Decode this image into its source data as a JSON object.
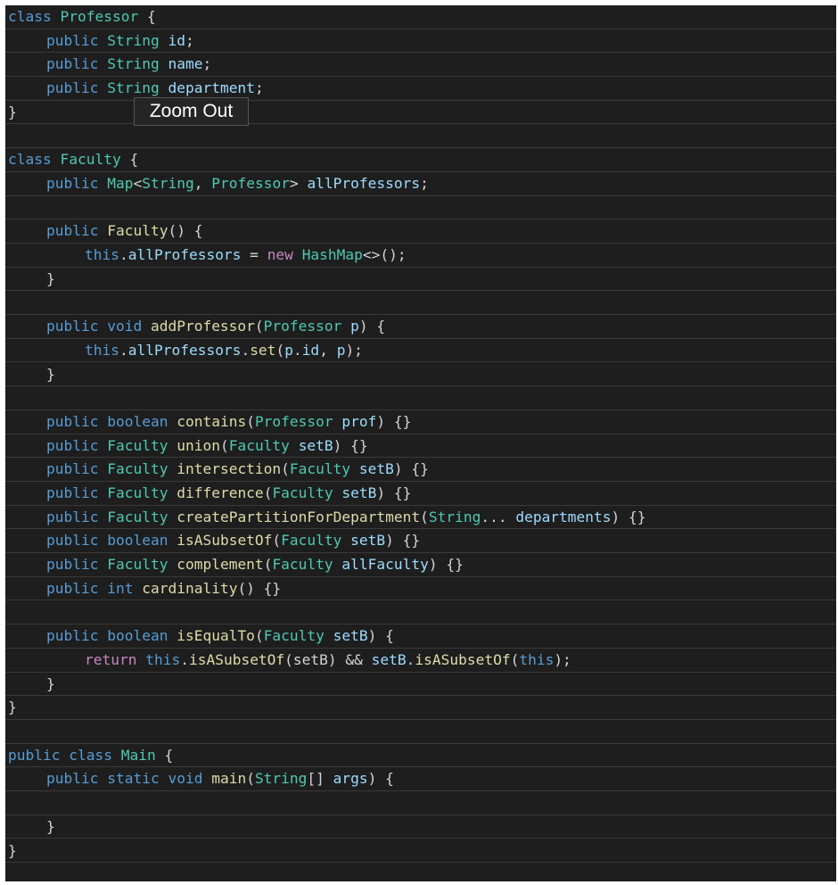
{
  "tooltip": {
    "label": "Zoom Out"
  },
  "colors": {
    "background": "#1e1e1e",
    "keyword": "#569cd6",
    "type": "#4ec9b0",
    "variable": "#9cdcfe",
    "function": "#dcdcaa",
    "control": "#c586c0",
    "punctuation": "#d4d4d4"
  },
  "lines": [
    {
      "indent": 0,
      "tokens": [
        [
          "kw",
          "class"
        ],
        [
          "p",
          " "
        ],
        [
          "type",
          "Professor"
        ],
        [
          "p",
          " {"
        ]
      ]
    },
    {
      "indent": 1,
      "tokens": [
        [
          "kw",
          "public"
        ],
        [
          "p",
          " "
        ],
        [
          "type",
          "String"
        ],
        [
          "p",
          " "
        ],
        [
          "var",
          "id"
        ],
        [
          "p",
          ";"
        ]
      ]
    },
    {
      "indent": 1,
      "tokens": [
        [
          "kw",
          "public"
        ],
        [
          "p",
          " "
        ],
        [
          "type",
          "String"
        ],
        [
          "p",
          " "
        ],
        [
          "var",
          "name"
        ],
        [
          "p",
          ";"
        ]
      ]
    },
    {
      "indent": 1,
      "tokens": [
        [
          "kw",
          "public"
        ],
        [
          "p",
          " "
        ],
        [
          "type",
          "String"
        ],
        [
          "p",
          " "
        ],
        [
          "var",
          "department"
        ],
        [
          "p",
          ";"
        ]
      ]
    },
    {
      "indent": 0,
      "tokens": [
        [
          "p",
          "}"
        ]
      ]
    },
    {
      "indent": 0,
      "tokens": []
    },
    {
      "indent": 0,
      "tokens": [
        [
          "kw",
          "class"
        ],
        [
          "p",
          " "
        ],
        [
          "type",
          "Faculty"
        ],
        [
          "p",
          " {"
        ]
      ]
    },
    {
      "indent": 1,
      "tokens": [
        [
          "kw",
          "public"
        ],
        [
          "p",
          " "
        ],
        [
          "type",
          "Map"
        ],
        [
          "p",
          "<"
        ],
        [
          "type",
          "String"
        ],
        [
          "p",
          ", "
        ],
        [
          "type",
          "Professor"
        ],
        [
          "p",
          "> "
        ],
        [
          "var",
          "allProfessors"
        ],
        [
          "p",
          ";"
        ]
      ]
    },
    {
      "indent": 0,
      "tokens": []
    },
    {
      "indent": 1,
      "tokens": [
        [
          "kw",
          "public"
        ],
        [
          "p",
          " "
        ],
        [
          "fn",
          "Faculty"
        ],
        [
          "p",
          "() {"
        ]
      ]
    },
    {
      "indent": 2,
      "tokens": [
        [
          "kw",
          "this"
        ],
        [
          "p",
          "."
        ],
        [
          "var",
          "allProfessors"
        ],
        [
          "p",
          " = "
        ],
        [
          "ctl",
          "new"
        ],
        [
          "p",
          " "
        ],
        [
          "type",
          "HashMap"
        ],
        [
          "p",
          "<>();"
        ]
      ]
    },
    {
      "indent": 1,
      "tokens": [
        [
          "p",
          "}"
        ]
      ]
    },
    {
      "indent": 0,
      "tokens": []
    },
    {
      "indent": 1,
      "tokens": [
        [
          "kw",
          "public"
        ],
        [
          "p",
          " "
        ],
        [
          "kw",
          "void"
        ],
        [
          "p",
          " "
        ],
        [
          "fn",
          "addProfessor"
        ],
        [
          "p",
          "("
        ],
        [
          "type",
          "Professor"
        ],
        [
          "p",
          " "
        ],
        [
          "var",
          "p"
        ],
        [
          "p",
          ") {"
        ]
      ]
    },
    {
      "indent": 2,
      "tokens": [
        [
          "kw",
          "this"
        ],
        [
          "p",
          "."
        ],
        [
          "var",
          "allProfessors"
        ],
        [
          "p",
          "."
        ],
        [
          "fn",
          "set"
        ],
        [
          "p",
          "("
        ],
        [
          "var",
          "p"
        ],
        [
          "p",
          "."
        ],
        [
          "var",
          "id"
        ],
        [
          "p",
          ", "
        ],
        [
          "var",
          "p"
        ],
        [
          "p",
          ");"
        ]
      ]
    },
    {
      "indent": 1,
      "tokens": [
        [
          "p",
          "}"
        ]
      ]
    },
    {
      "indent": 0,
      "tokens": []
    },
    {
      "indent": 1,
      "tokens": [
        [
          "kw",
          "public"
        ],
        [
          "p",
          " "
        ],
        [
          "kw",
          "boolean"
        ],
        [
          "p",
          " "
        ],
        [
          "fn",
          "contains"
        ],
        [
          "p",
          "("
        ],
        [
          "type",
          "Professor"
        ],
        [
          "p",
          " "
        ],
        [
          "var",
          "prof"
        ],
        [
          "p",
          ") {}"
        ]
      ]
    },
    {
      "indent": 1,
      "tokens": [
        [
          "kw",
          "public"
        ],
        [
          "p",
          " "
        ],
        [
          "type",
          "Faculty"
        ],
        [
          "p",
          " "
        ],
        [
          "fn",
          "union"
        ],
        [
          "p",
          "("
        ],
        [
          "type",
          "Faculty"
        ],
        [
          "p",
          " "
        ],
        [
          "var",
          "setB"
        ],
        [
          "p",
          ") {}"
        ]
      ]
    },
    {
      "indent": 1,
      "tokens": [
        [
          "kw",
          "public"
        ],
        [
          "p",
          " "
        ],
        [
          "type",
          "Faculty"
        ],
        [
          "p",
          " "
        ],
        [
          "fn",
          "intersection"
        ],
        [
          "p",
          "("
        ],
        [
          "type",
          "Faculty"
        ],
        [
          "p",
          " "
        ],
        [
          "var",
          "setB"
        ],
        [
          "p",
          ") {}"
        ]
      ]
    },
    {
      "indent": 1,
      "tokens": [
        [
          "kw",
          "public"
        ],
        [
          "p",
          " "
        ],
        [
          "type",
          "Faculty"
        ],
        [
          "p",
          " "
        ],
        [
          "fn",
          "difference"
        ],
        [
          "p",
          "("
        ],
        [
          "type",
          "Faculty"
        ],
        [
          "p",
          " "
        ],
        [
          "var",
          "setB"
        ],
        [
          "p",
          ") {}"
        ]
      ]
    },
    {
      "indent": 1,
      "tokens": [
        [
          "kw",
          "public"
        ],
        [
          "p",
          " "
        ],
        [
          "type",
          "Faculty"
        ],
        [
          "p",
          " "
        ],
        [
          "fn",
          "createPartitionForDepartment"
        ],
        [
          "p",
          "("
        ],
        [
          "type",
          "String"
        ],
        [
          "p",
          "... "
        ],
        [
          "var",
          "departments"
        ],
        [
          "p",
          ") {}"
        ]
      ]
    },
    {
      "indent": 1,
      "tokens": [
        [
          "kw",
          "public"
        ],
        [
          "p",
          " "
        ],
        [
          "kw",
          "boolean"
        ],
        [
          "p",
          " "
        ],
        [
          "fn",
          "isASubsetOf"
        ],
        [
          "p",
          "("
        ],
        [
          "type",
          "Faculty"
        ],
        [
          "p",
          " "
        ],
        [
          "var",
          "setB"
        ],
        [
          "p",
          ") {}"
        ]
      ]
    },
    {
      "indent": 1,
      "tokens": [
        [
          "kw",
          "public"
        ],
        [
          "p",
          " "
        ],
        [
          "type",
          "Faculty"
        ],
        [
          "p",
          " "
        ],
        [
          "fn",
          "complement"
        ],
        [
          "p",
          "("
        ],
        [
          "type",
          "Faculty"
        ],
        [
          "p",
          " "
        ],
        [
          "var",
          "allFaculty"
        ],
        [
          "p",
          ") {}"
        ]
      ]
    },
    {
      "indent": 1,
      "tokens": [
        [
          "kw",
          "public"
        ],
        [
          "p",
          " "
        ],
        [
          "kw",
          "int"
        ],
        [
          "p",
          " "
        ],
        [
          "fn",
          "cardinality"
        ],
        [
          "p",
          "() {}"
        ]
      ]
    },
    {
      "indent": 0,
      "tokens": []
    },
    {
      "indent": 1,
      "tokens": [
        [
          "kw",
          "public"
        ],
        [
          "p",
          " "
        ],
        [
          "kw",
          "boolean"
        ],
        [
          "p",
          " "
        ],
        [
          "fn",
          "isEqualTo"
        ],
        [
          "p",
          "("
        ],
        [
          "type",
          "Faculty"
        ],
        [
          "p",
          " "
        ],
        [
          "var",
          "setB"
        ],
        [
          "p",
          ") {"
        ]
      ]
    },
    {
      "indent": 2,
      "tokens": [
        [
          "ctl",
          "return"
        ],
        [
          "p",
          " "
        ],
        [
          "kw",
          "this"
        ],
        [
          "p",
          "."
        ],
        [
          "fn",
          "isASubsetOf"
        ],
        [
          "p",
          "(setB) && "
        ],
        [
          "var",
          "setB"
        ],
        [
          "p",
          "."
        ],
        [
          "fn",
          "isASubsetOf"
        ],
        [
          "p",
          "("
        ],
        [
          "kw",
          "this"
        ],
        [
          "p",
          ");"
        ]
      ]
    },
    {
      "indent": 1,
      "tokens": [
        [
          "p",
          "}"
        ]
      ]
    },
    {
      "indent": 0,
      "tokens": [
        [
          "p",
          "}"
        ]
      ]
    },
    {
      "indent": 0,
      "tokens": []
    },
    {
      "indent": 0,
      "tokens": [
        [
          "kw",
          "public"
        ],
        [
          "p",
          " "
        ],
        [
          "kw",
          "class"
        ],
        [
          "p",
          " "
        ],
        [
          "type",
          "Main"
        ],
        [
          "p",
          " {"
        ]
      ]
    },
    {
      "indent": 1,
      "tokens": [
        [
          "kw",
          "public"
        ],
        [
          "p",
          " "
        ],
        [
          "kw",
          "static"
        ],
        [
          "p",
          " "
        ],
        [
          "kw",
          "void"
        ],
        [
          "p",
          " "
        ],
        [
          "fn",
          "main"
        ],
        [
          "p",
          "("
        ],
        [
          "type",
          "String"
        ],
        [
          "p",
          "[] "
        ],
        [
          "var",
          "args"
        ],
        [
          "p",
          ") {"
        ]
      ]
    },
    {
      "indent": 0,
      "tokens": []
    },
    {
      "indent": 1,
      "tokens": [
        [
          "p",
          "}"
        ]
      ]
    },
    {
      "indent": 0,
      "tokens": [
        [
          "p",
          "}"
        ]
      ]
    },
    {
      "indent": 0,
      "tokens": []
    }
  ]
}
